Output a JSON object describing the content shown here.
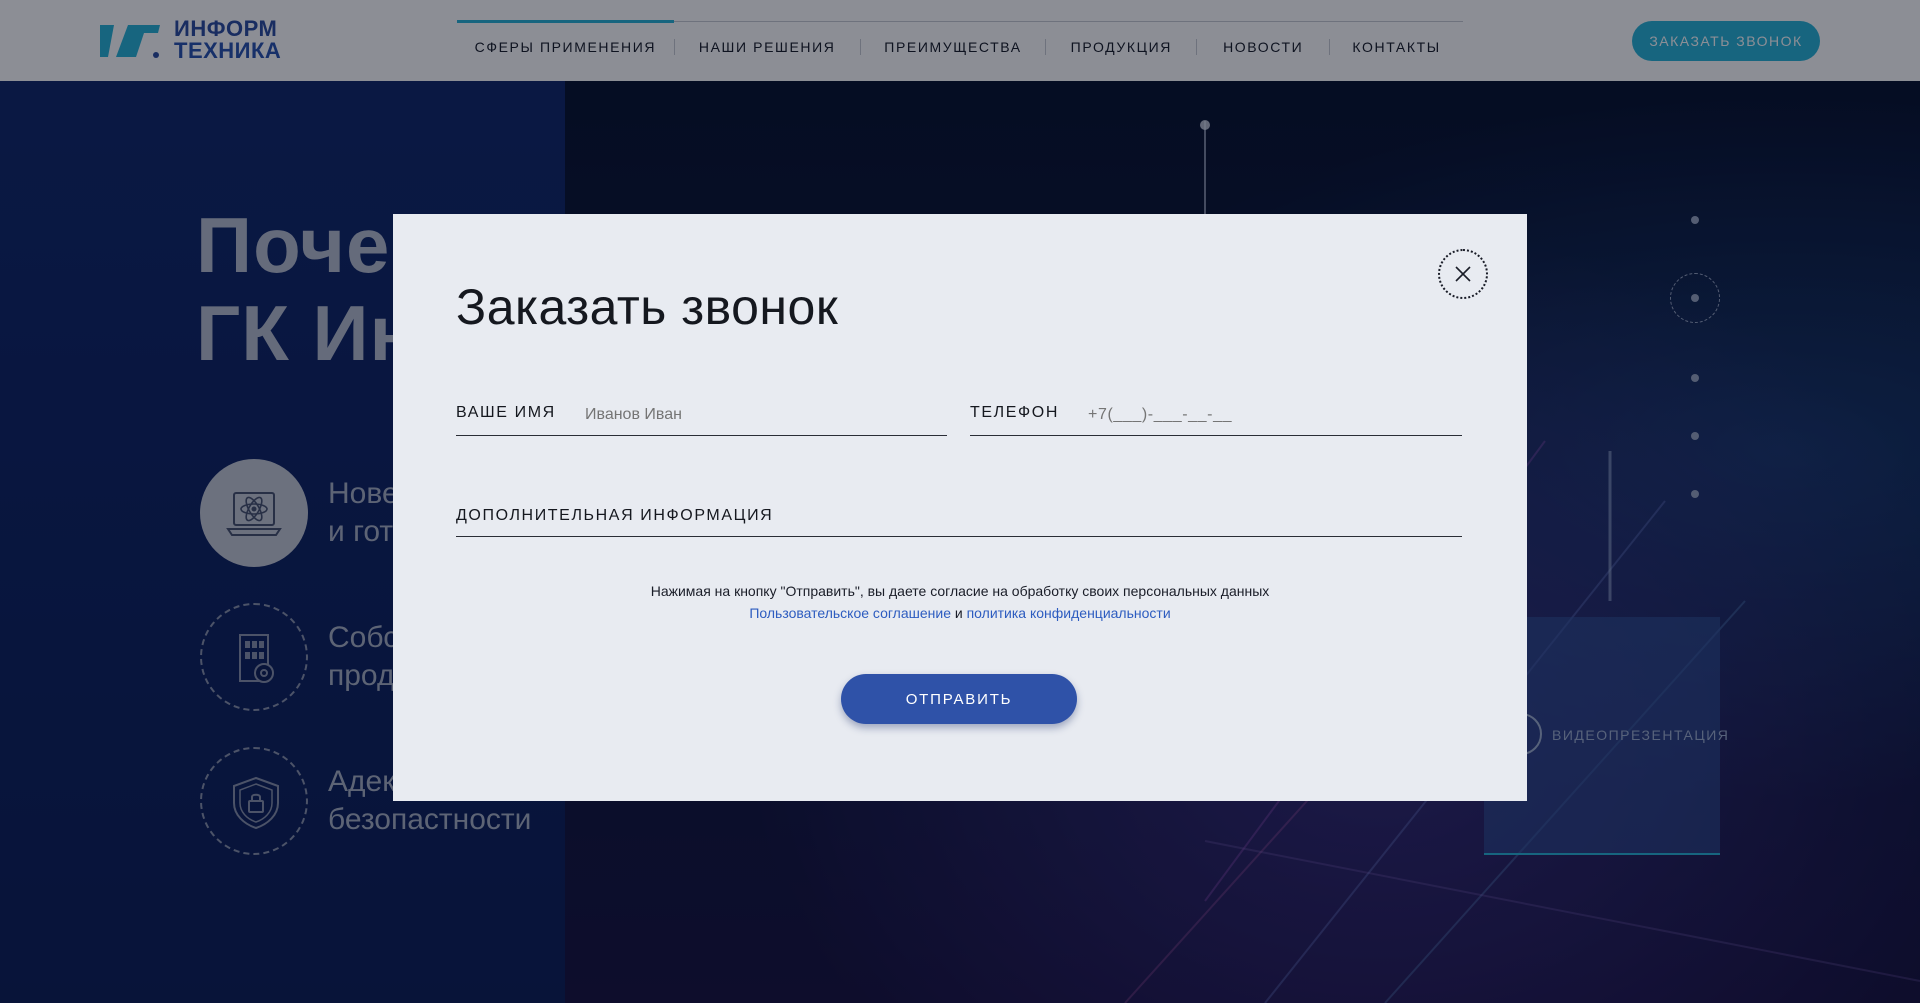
{
  "header": {
    "logo": {
      "line1": "ИНФОРМ",
      "line2": "ТЕХНИКА",
      "mark_color": "#2bb5d8",
      "text_color": "#2e4fa0"
    },
    "nav": [
      {
        "label": "СФЕРЫ ПРИМЕНЕНИЯ",
        "active": true
      },
      {
        "label": "НАШИ РЕШЕНИЯ"
      },
      {
        "label": "ПРЕИМУЩЕСТВА"
      },
      {
        "label": "ПРОДУКЦИЯ"
      },
      {
        "label": "НОВОСТИ"
      },
      {
        "label": "КОНТАКТЫ"
      }
    ],
    "call_button": "ЗАКАЗАТЬ ЗВОНОК",
    "accent_color": "#2bb5d8"
  },
  "background": {
    "hero_title_line1": "Почем",
    "hero_title_line2": "ГК Ин",
    "features": [
      {
        "icon": "atom-laptop-icon",
        "line1": "Нове",
        "line2": "и гот"
      },
      {
        "icon": "building-gear-icon",
        "line1": "Собс",
        "line2": "прод"
      },
      {
        "icon": "shield-lock-icon",
        "line1": "Адек",
        "line2": "безопастности"
      }
    ],
    "video_label": "ВИДЕОПРЕЗЕНТАЦИЯ"
  },
  "modal": {
    "title": "Заказать звонок",
    "fields": {
      "name": {
        "label": "ВАШЕ ИМЯ",
        "placeholder": "Иванов Иван"
      },
      "phone": {
        "label": "ТЕЛЕФОН",
        "placeholder": "+7(___)-___-__-__"
      },
      "info": {
        "label": "ДОПОЛНИТЕЛЬНАЯ ИНФОРМАЦИЯ",
        "placeholder": ""
      }
    },
    "consent": {
      "text": "Нажимая на кнопку \"Отправить\", вы даете согласие на обработку своих персональных данных",
      "agreement_link": "Пользовательское соглашение",
      "conjunction": "и",
      "privacy_link": "политика конфиденциальности"
    },
    "submit_label": "ОТПРАВИТЬ",
    "button_color": "#2f52a8",
    "link_color": "#2d5cc0"
  }
}
